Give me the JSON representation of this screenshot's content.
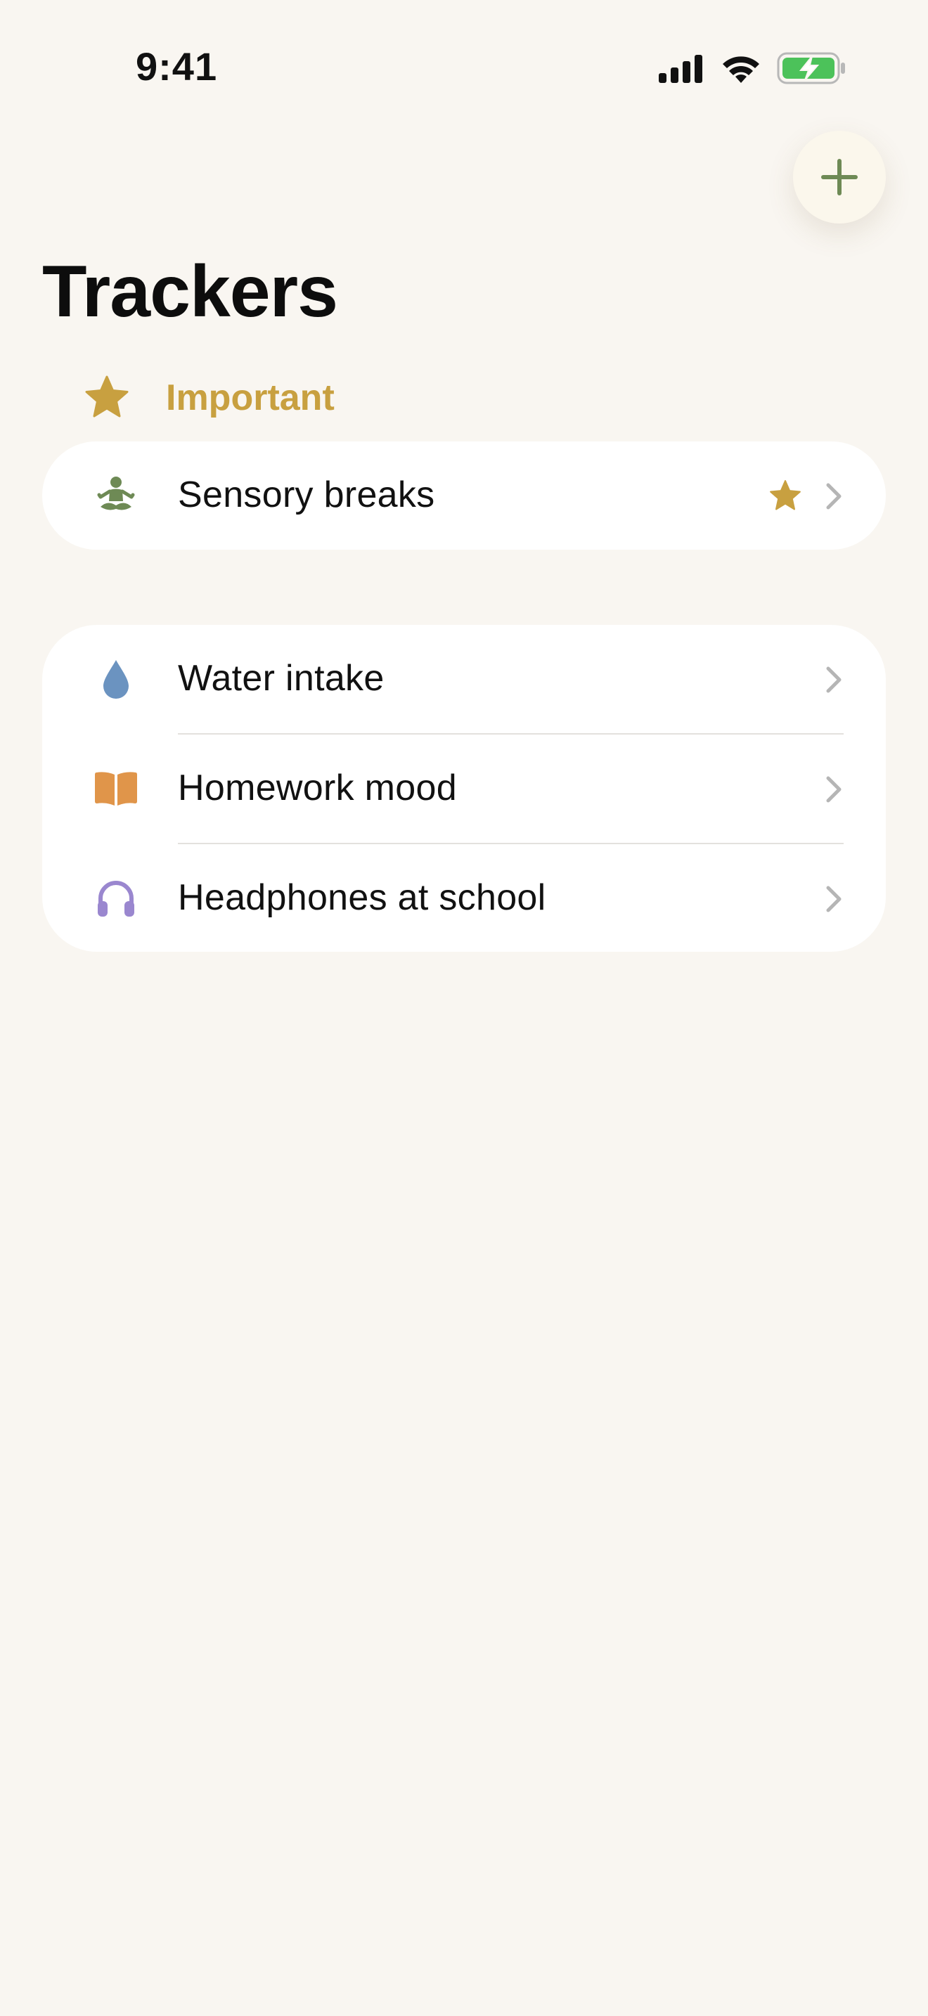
{
  "status_bar": {
    "time": "9:41",
    "icons": [
      "cellular-signal-icon",
      "wifi-icon",
      "battery-charging-icon"
    ]
  },
  "header": {
    "title": "Trackers",
    "add_button_icon": "plus-icon"
  },
  "important_section": {
    "label": "Important",
    "icon": "star-icon",
    "items": [
      {
        "label": "Sensory breaks",
        "icon": "meditation-figure-icon",
        "starred": true
      }
    ]
  },
  "trackers": {
    "items": [
      {
        "label": "Water intake",
        "icon": "water-drop-icon"
      },
      {
        "label": "Homework mood",
        "icon": "open-book-icon"
      },
      {
        "label": "Headphones at school",
        "icon": "headphones-icon"
      }
    ]
  },
  "colors": {
    "background": "#f9f6f1",
    "accent_gold": "#c8a040",
    "green": "#6e8a55",
    "blue": "#6b93c0",
    "orange": "#e0954a",
    "purple": "#9a87cf",
    "battery_green": "#4cc25a"
  }
}
